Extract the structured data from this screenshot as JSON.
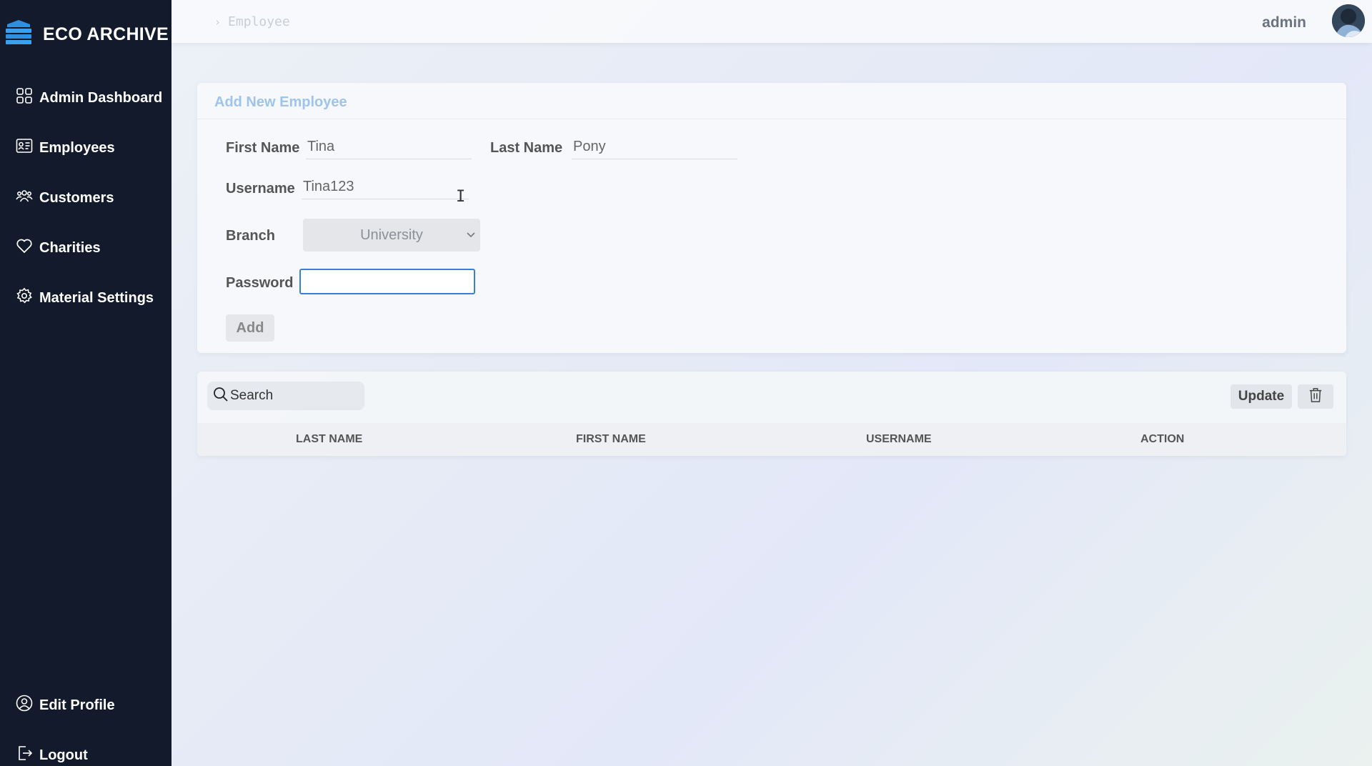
{
  "app": {
    "name": "ECO ARCHIVE"
  },
  "sidebar": {
    "items": [
      {
        "label": "Admin Dashboard",
        "icon": "grid-icon"
      },
      {
        "label": "Employees",
        "icon": "id-card-icon"
      },
      {
        "label": "Customers",
        "icon": "users-icon"
      },
      {
        "label": "Charities",
        "icon": "heart-icon"
      },
      {
        "label": "Material Settings",
        "icon": "gear-icon"
      }
    ],
    "footer": [
      {
        "label": "Edit Profile",
        "icon": "user-circle-icon"
      },
      {
        "label": "Logout",
        "icon": "logout-icon"
      }
    ]
  },
  "header": {
    "breadcrumb": "Employee",
    "user": "admin"
  },
  "form": {
    "title": "Add New Employee",
    "first_name_label": "First Name",
    "first_name_value": "Tina",
    "last_name_label": "Last Name",
    "last_name_value": "Pony",
    "username_label": "Username",
    "username_value": "Tina123",
    "branch_label": "Branch",
    "branch_value": "University",
    "password_label": "Password",
    "password_value": "",
    "add_label": "Add"
  },
  "table": {
    "search_placeholder": "Search",
    "update_label": "Update",
    "columns": [
      "LAST NAME",
      "FIRST NAME",
      "USERNAME",
      "ACTION"
    ]
  },
  "colors": {
    "sidebar_bg": "#121a2b",
    "accent": "#3b7dd8",
    "title": "#9fc4ea"
  }
}
